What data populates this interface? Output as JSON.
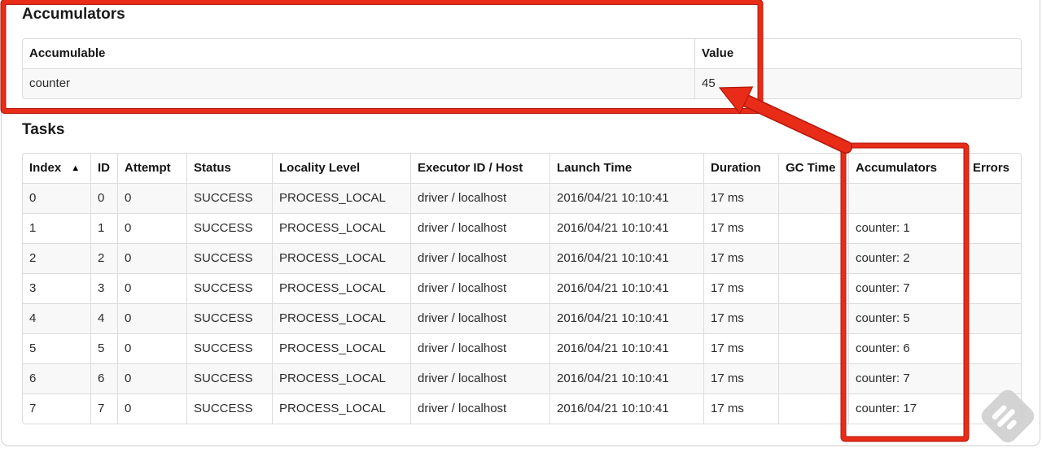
{
  "colors": {
    "annotation_red": "#e82c18",
    "annotation_red_dark": "#b3160a",
    "table_border": "#dcdcdc",
    "row_stripe": "#f8f8f8"
  },
  "accumulators_section": {
    "title": "Accumulators",
    "table": {
      "headers": [
        "Accumulable",
        "Value"
      ],
      "rows": [
        [
          "counter",
          "45"
        ]
      ]
    }
  },
  "tasks_section": {
    "title": "Tasks",
    "table": {
      "headers": [
        "Index",
        "ID",
        "Attempt",
        "Status",
        "Locality Level",
        "Executor ID / Host",
        "Launch Time",
        "Duration",
        "GC Time",
        "Accumulators",
        "Errors"
      ],
      "sort_column": "Index",
      "sort_indicator": "▲",
      "rows": [
        [
          "0",
          "0",
          "0",
          "SUCCESS",
          "PROCESS_LOCAL",
          "driver / localhost",
          "2016/04/21 10:10:41",
          "17 ms",
          "",
          "",
          ""
        ],
        [
          "1",
          "1",
          "0",
          "SUCCESS",
          "PROCESS_LOCAL",
          "driver / localhost",
          "2016/04/21 10:10:41",
          "17 ms",
          "",
          "counter: 1",
          ""
        ],
        [
          "2",
          "2",
          "0",
          "SUCCESS",
          "PROCESS_LOCAL",
          "driver / localhost",
          "2016/04/21 10:10:41",
          "17 ms",
          "",
          "counter: 2",
          ""
        ],
        [
          "3",
          "3",
          "0",
          "SUCCESS",
          "PROCESS_LOCAL",
          "driver / localhost",
          "2016/04/21 10:10:41",
          "17 ms",
          "",
          "counter: 7",
          ""
        ],
        [
          "4",
          "4",
          "0",
          "SUCCESS",
          "PROCESS_LOCAL",
          "driver / localhost",
          "2016/04/21 10:10:41",
          "17 ms",
          "",
          "counter: 5",
          ""
        ],
        [
          "5",
          "5",
          "0",
          "SUCCESS",
          "PROCESS_LOCAL",
          "driver / localhost",
          "2016/04/21 10:10:41",
          "17 ms",
          "",
          "counter: 6",
          ""
        ],
        [
          "6",
          "6",
          "0",
          "SUCCESS",
          "PROCESS_LOCAL",
          "driver / localhost",
          "2016/04/21 10:10:41",
          "17 ms",
          "",
          "counter: 7",
          ""
        ],
        [
          "7",
          "7",
          "0",
          "SUCCESS",
          "PROCESS_LOCAL",
          "driver / localhost",
          "2016/04/21 10:10:41",
          "17 ms",
          "",
          "counter: 17",
          ""
        ]
      ]
    }
  },
  "annotations": {
    "summary_box_target": "Accumulators summary table",
    "column_box_target": "Accumulators task column",
    "arrow_points_to": "45"
  }
}
